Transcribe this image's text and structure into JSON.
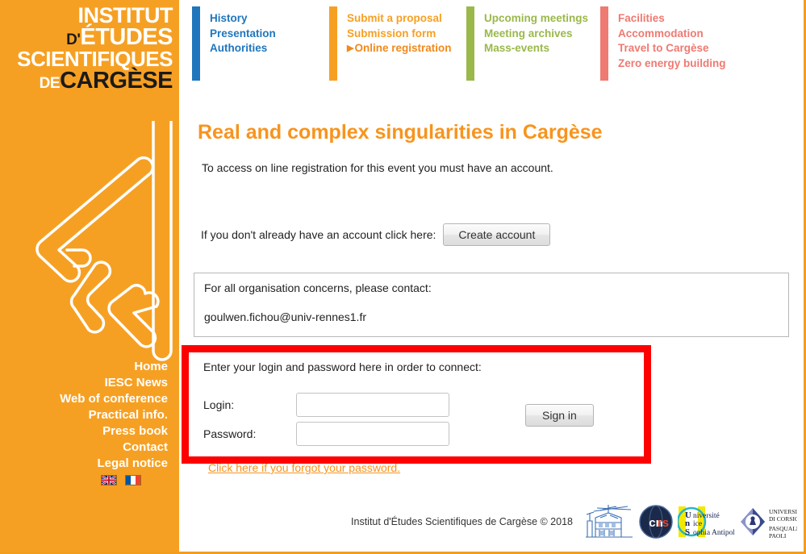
{
  "sidebar": {
    "logo": {
      "line1": "INSTITUT",
      "line2_prefix": "D'",
      "line2": "ÉTUDES",
      "line3": "SCIENTIFIQUES",
      "line4_prefix": "DE",
      "line4": "CARGÈSE"
    },
    "nav_items": [
      {
        "label": "Home"
      },
      {
        "label": "IESC News"
      },
      {
        "label": "Web of conference"
      },
      {
        "label": "Practical info."
      },
      {
        "label": "Press book"
      },
      {
        "label": "Contact"
      },
      {
        "label": "Legal notice"
      }
    ],
    "flags": [
      {
        "name": "uk-flag",
        "title": "English"
      },
      {
        "name": "france-flag",
        "title": "Français"
      }
    ],
    "background_color": "#f6a023",
    "deco_icon": "iesc-monogram-icon"
  },
  "topnav": {
    "columns": [
      {
        "accent_color": "#1f76bd",
        "links": [
          {
            "label": "History",
            "active": false
          },
          {
            "label": "Presentation",
            "active": false
          },
          {
            "label": "Authorities",
            "active": false
          }
        ]
      },
      {
        "accent_color": "#f6a023",
        "links": [
          {
            "label": "Submit a proposal",
            "active": false
          },
          {
            "label": "Submission form",
            "active": false
          },
          {
            "label": "Online registration",
            "active": true
          }
        ]
      },
      {
        "accent_color": "#9bb84b",
        "links": [
          {
            "label": "Upcoming meetings",
            "active": false
          },
          {
            "label": "Meeting archives",
            "active": false
          },
          {
            "label": "Mass-events",
            "active": false
          }
        ]
      },
      {
        "accent_color": "#ee7a72",
        "links": [
          {
            "label": "Facilities",
            "active": false
          },
          {
            "label": "Accommodation",
            "active": false
          },
          {
            "label": "Travel to Cargèse",
            "active": false
          },
          {
            "label": "Zero energy building",
            "active": false
          }
        ]
      }
    ]
  },
  "main": {
    "page_title": "Real and complex singularities in Cargèse",
    "intro_text": "To access on line registration for this event you must have an account.",
    "create_account": {
      "label": "If you don't already have an account click here:",
      "button_label": "Create account"
    },
    "contact_box": {
      "line1": "For all organisation concerns, please contact:",
      "email": "goulwen.fichou@univ-rennes1.fr"
    },
    "forgot_password_link": "Click here if you forgot your password.",
    "login_form": {
      "prompt": "Enter your login and password here in order to connect:",
      "login_label": "Login:",
      "login_value": "",
      "login_placeholder": "",
      "password_label": "Password:",
      "password_value": "",
      "password_placeholder": "",
      "signin_label": "Sign in",
      "highlight_color": "#fd0000"
    }
  },
  "footer": {
    "copyright": "Institut d'Études Scientifiques de Cargèse © 2018",
    "logos": [
      {
        "name": "iesc-building-logo",
        "alt": "IESC"
      },
      {
        "name": "cnrs-logo",
        "alt": "CNRS"
      },
      {
        "name": "universite-nice-sophia-antipolis-logo",
        "alt": "Université Nice Sophia Antipolis"
      },
      {
        "name": "universita-di-corsica-pasquale-paoli-logo",
        "alt": "Università di Corsica Pasquale Paoli"
      }
    ]
  },
  "theme": {
    "orange": "#f6a023",
    "title_orange": "#f7941d",
    "blue": "#1f76bd",
    "green": "#9bb84b",
    "salmon": "#ee7a72",
    "red_highlight": "#fd0000"
  }
}
